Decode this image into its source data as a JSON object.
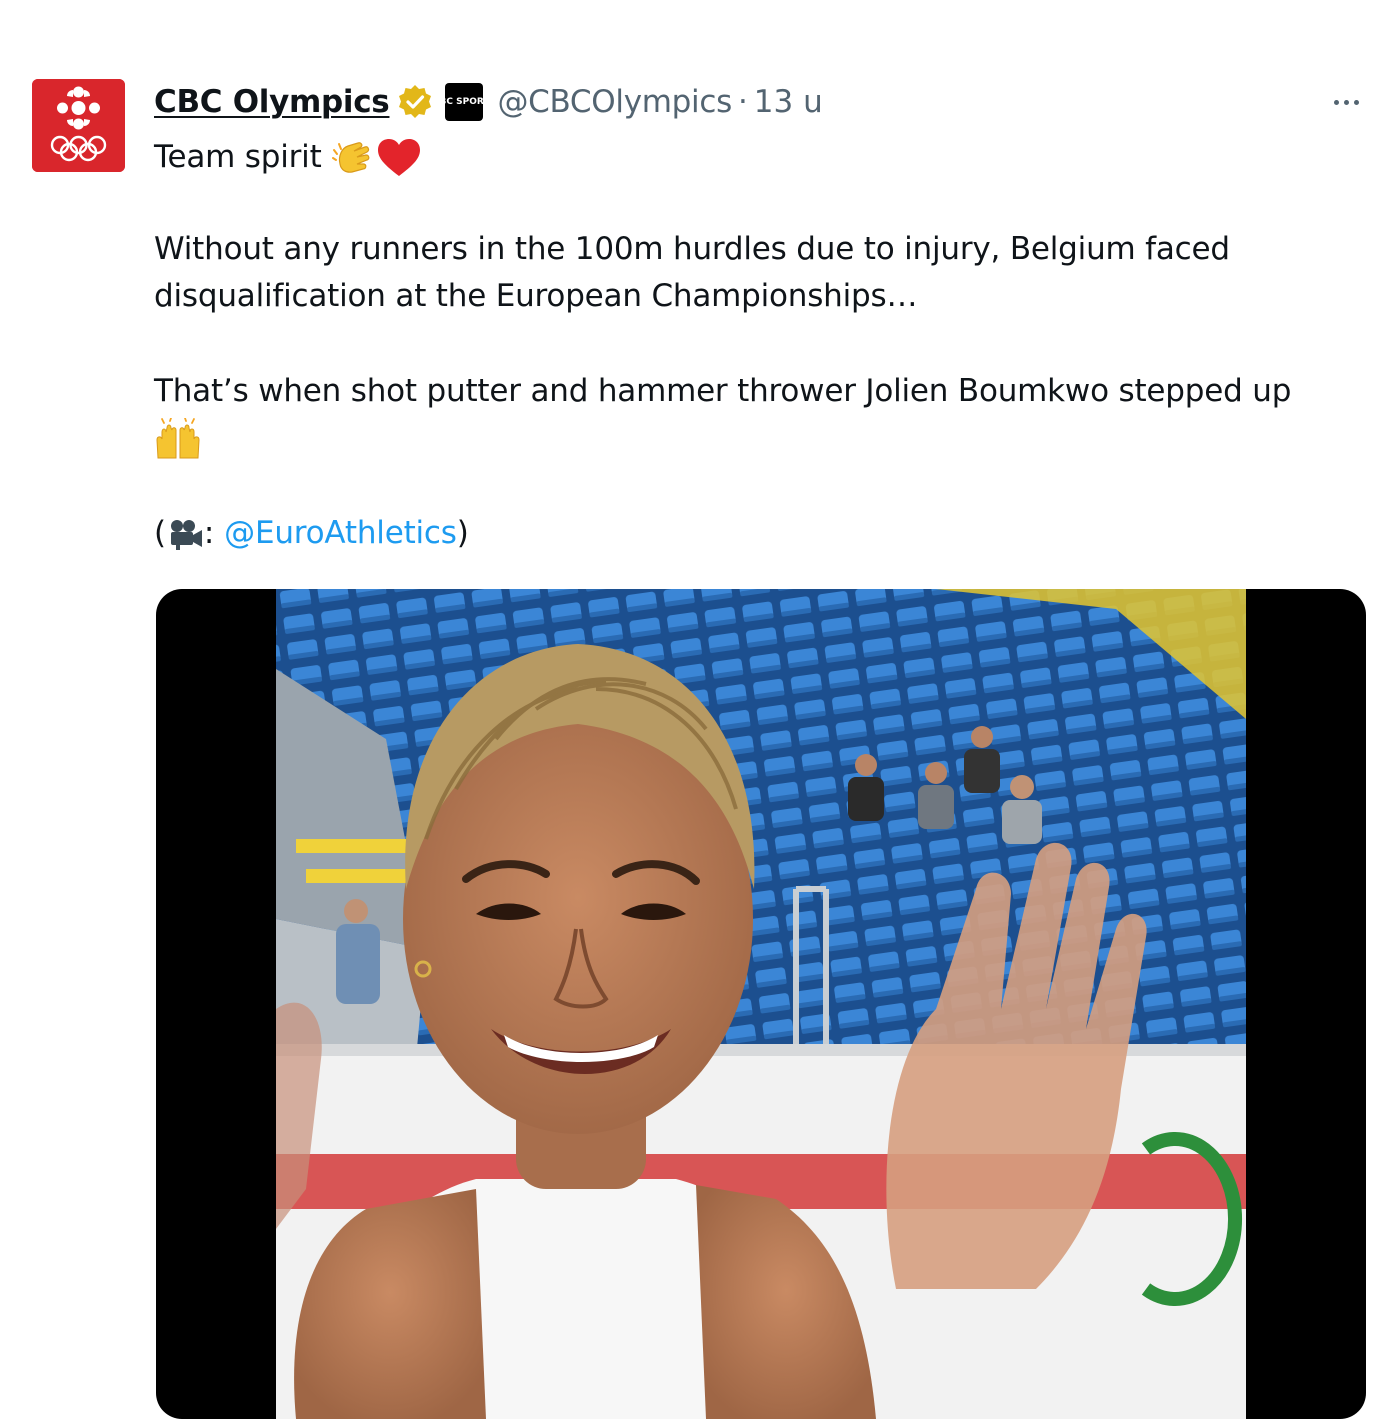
{
  "author": {
    "display_name": "CBC Olympics",
    "handle": "@CBCOlympics",
    "separator": "·",
    "time": "13 u",
    "affiliate_badge_text": "CBC SPORTS",
    "avatar_icon": "cbc-olympic-rings-logo",
    "verified_icon": "gold-verified-badge-icon"
  },
  "tweet": {
    "line1_text": "Team spirit",
    "line1_emojis": [
      "clapping-hands-emoji",
      "red-heart-emoji"
    ],
    "paragraph2": "Without any runners in the 100m hurdles due to injury, Belgium faced disqualification at the European Championships…",
    "paragraph3": "That’s when shot putter and hammer thrower Jolien Boumkwo stepped up",
    "paragraph3_emoji": "raising-hands-emoji",
    "credit_open": "(",
    "credit_emoji": "movie-camera-emoji",
    "credit_colon": ":",
    "credit_mention": "@EuroAthletics",
    "credit_close": ")"
  },
  "media": {
    "type": "video",
    "description_icon": "video-thumbnail"
  },
  "colors": {
    "brand_red": "#d9262c",
    "link_blue": "#1d9bf0",
    "secondary_text": "#536471",
    "verified_gold": "#e2b719"
  }
}
